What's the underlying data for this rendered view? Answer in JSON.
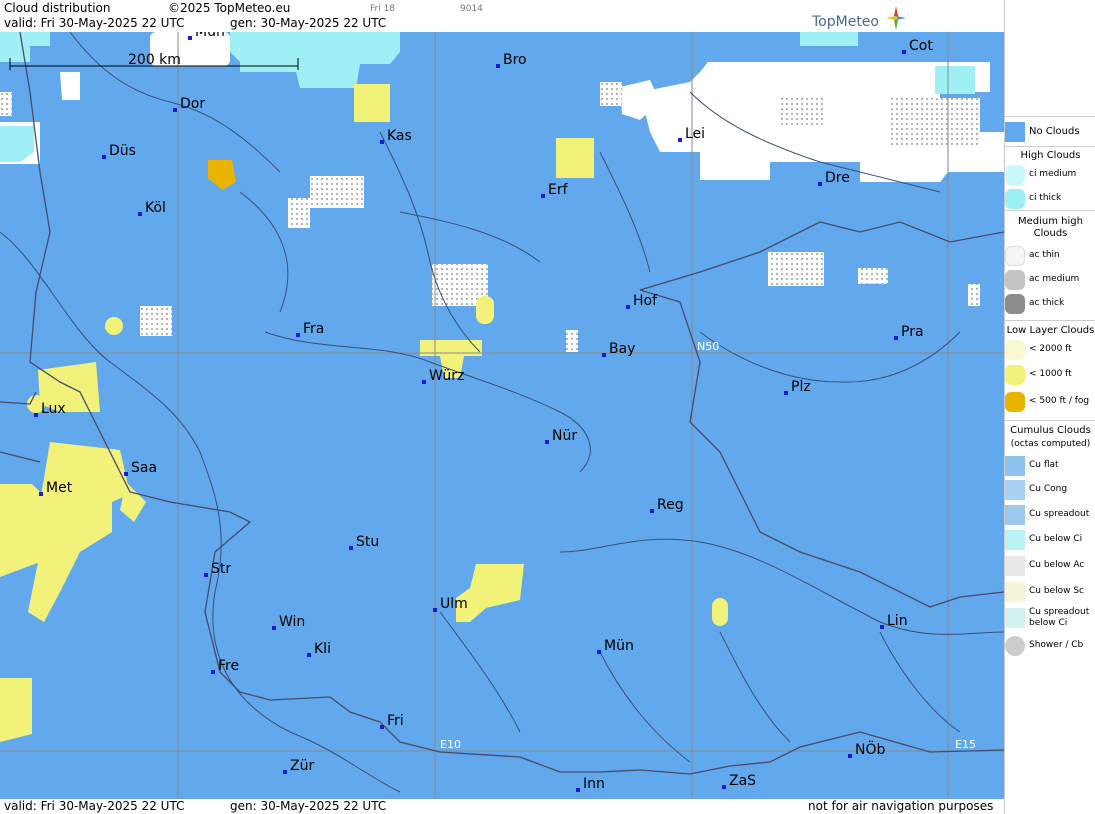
{
  "header": {
    "title": "Cloud distribution",
    "copyright": "©2025 TopMeteo.eu",
    "valid": "valid:  Fri  30-May-2025  22 UTC",
    "gen": "gen: 30-May-2025  22 UTC",
    "tiny1": "Fri 18",
    "tiny2": "9014",
    "logo": "TopMeteo"
  },
  "footer": {
    "valid": "valid:  Fri  30-May-2025  22 UTC",
    "gen": "gen: 30-May-2025 22 UTC",
    "note": "not for air navigation purposes"
  },
  "map": {
    "scale_label": "200 km",
    "grid_labels": {
      "n50": "N50",
      "e10": "E10",
      "e15": "E15"
    },
    "cities": [
      "Mün",
      "Cot",
      "Bro",
      "Dor",
      "Kas",
      "Lei",
      "Düs",
      "Erf",
      "Dre",
      "Köl",
      "Hof",
      "Fra",
      "Pra",
      "Bay",
      "Würz",
      "Plz",
      "Lux",
      "Nür",
      "Saa",
      "Met",
      "Reg",
      "Stu",
      "Str",
      "Ulm",
      "Win",
      "Lin",
      "Kli",
      "Mün",
      "Fre",
      "Fri",
      "NÖb",
      "Zür",
      "Inn",
      "ZaS"
    ],
    "colors": {
      "no_clouds": "#62a8ec",
      "white": "#ffffff",
      "cyan": "#9ef0f4",
      "yellow": "#f2f27a",
      "orange": "#e8b400",
      "line": "#3a4f7a"
    }
  },
  "legend": {
    "no_clouds": "No Clouds",
    "high_title": "High Clouds",
    "ci_medium": "ci medium",
    "ci_thick": "ci thick",
    "medium_title": "Medium high Clouds",
    "ac_thin": "ac thin",
    "ac_medium": "ac medium",
    "ac_thick": "ac thick",
    "low_title": "Low Layer Clouds",
    "low1": "< 2000 ft",
    "low2": "< 1000 ft",
    "low3": "< 500 ft / fog",
    "cu_title": "Cumulus Clouds",
    "cu_sub": "(octas computed)",
    "cu_flat": "Cu flat",
    "cu_cong": "Cu Cong",
    "cu_spreadout": "Cu spreadout",
    "cu_below_ci": "Cu below Ci",
    "cu_below_ac": "Cu below Ac",
    "cu_below_sc": "Cu below Sc",
    "cu_spreadout_ci_1": "Cu spreadout",
    "cu_spreadout_ci_2": "below Ci",
    "shower": "Shower / Cb"
  }
}
